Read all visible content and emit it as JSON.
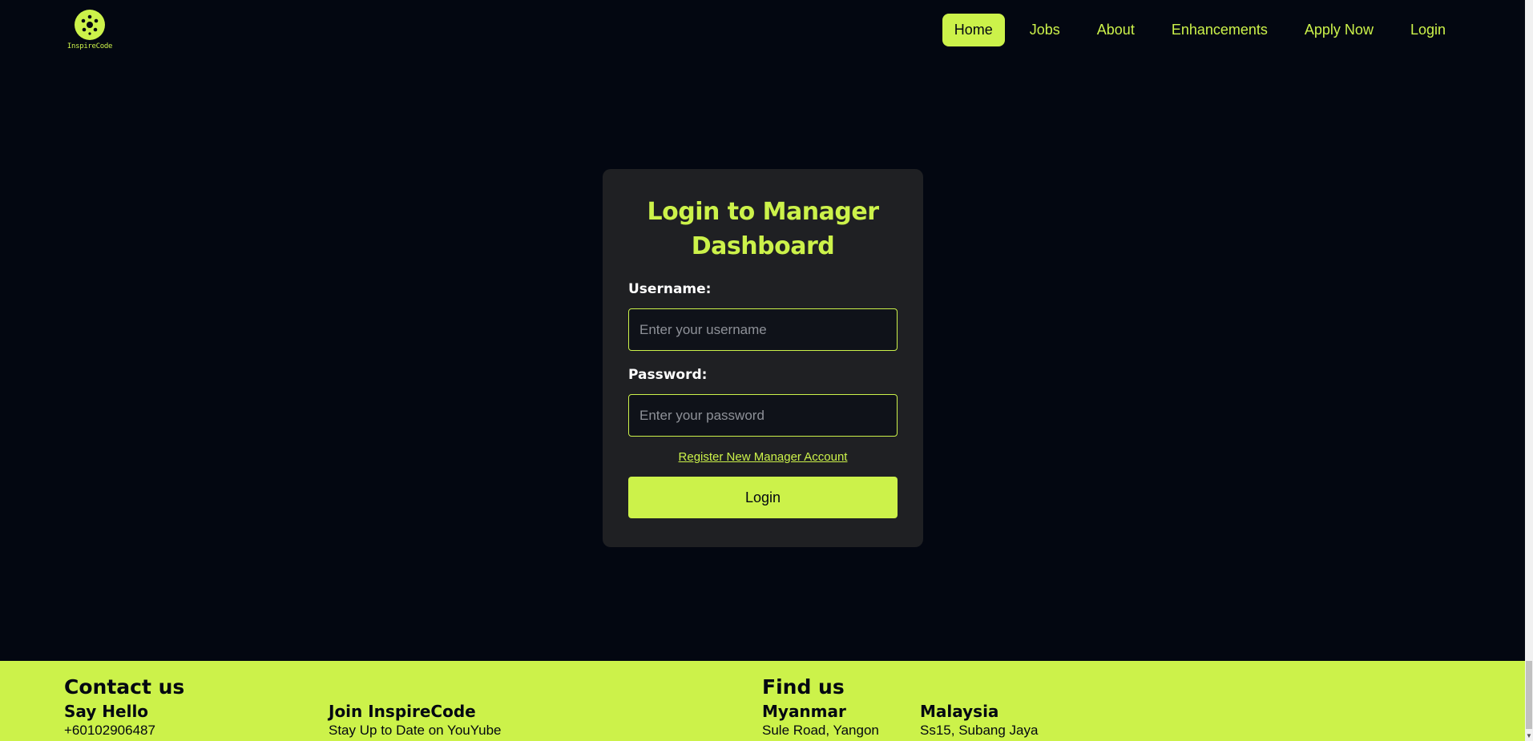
{
  "header": {
    "logo_text": "InspireCode",
    "nav": [
      "Home",
      "Jobs",
      "About",
      "Enhancements",
      "Apply Now",
      "Login"
    ],
    "active": "Home"
  },
  "login_card": {
    "title": "Login to Manager Dashboard",
    "username_label": "Username:",
    "username_placeholder": "Enter your username",
    "password_label": "Password:",
    "password_placeholder": "Enter your password",
    "register_link": "Register New Manager Account",
    "login_button": "Login"
  },
  "footer": {
    "contact_title": "Contact us",
    "say_hello": "Say Hello",
    "phone": "+60102906487",
    "join_title": "Join InspireCode",
    "join_text": "Stay Up to Date on YouYube",
    "find_title": "Find us",
    "location1_name": "Myanmar",
    "location1_address": "Sule Road, Yangon",
    "location2_name": "Malaysia",
    "location2_address": "Ss15, Subang Jaya"
  },
  "colors": {
    "accent": "#ccf24a",
    "background": "#030711",
    "card": "#1f2023"
  }
}
